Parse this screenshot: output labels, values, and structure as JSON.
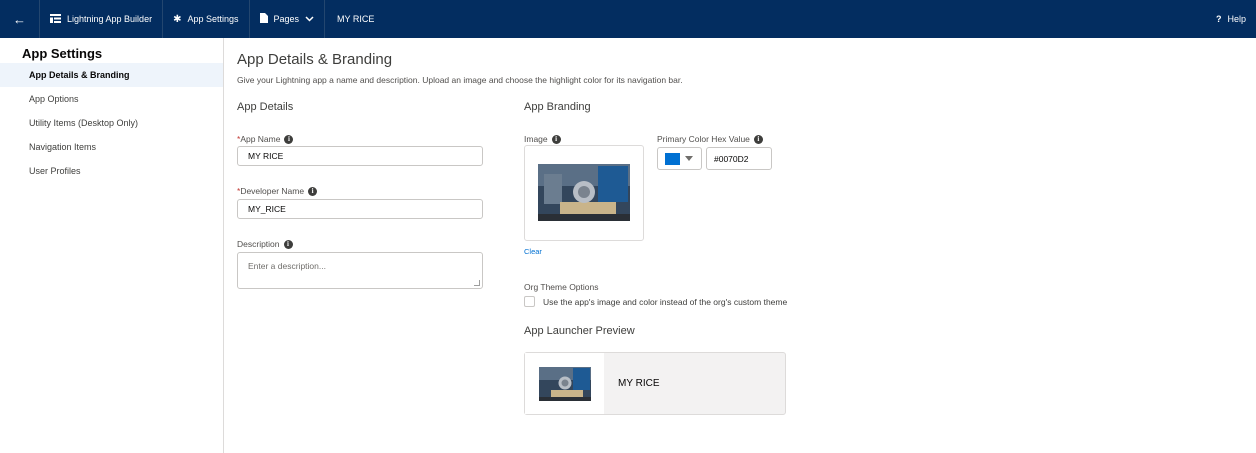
{
  "topbar": {
    "back_icon": "back-arrow-icon",
    "builder_label": "Lightning App Builder",
    "settings_label": "App Settings",
    "pages_label": "Pages",
    "app_title": "MY RICE",
    "help_label": "Help"
  },
  "sidebar": {
    "heading": "App Settings",
    "items": [
      {
        "label": "App Details & Branding",
        "active": true
      },
      {
        "label": "App Options",
        "active": false
      },
      {
        "label": "Utility Items (Desktop Only)",
        "active": false
      },
      {
        "label": "Navigation Items",
        "active": false
      },
      {
        "label": "User Profiles",
        "active": false
      }
    ]
  },
  "main": {
    "title": "App Details & Branding",
    "subtitle": "Give your Lightning app a name and description. Upload an image and choose the highlight color for its navigation bar.",
    "details": {
      "heading": "App Details",
      "app_name_label": "App Name",
      "app_name_value": "MY RICE",
      "dev_name_label": "Developer Name",
      "dev_name_value": "MY_RICE",
      "description_label": "Description",
      "description_placeholder": "Enter a description..."
    },
    "branding": {
      "heading": "App Branding",
      "image_label": "Image",
      "clear_label": "Clear",
      "color_label": "Primary Color Hex Value",
      "color_value": "#0070D2",
      "swatch_color": "#0070d2",
      "org_theme_label": "Org Theme Options",
      "org_theme_checkbox_label": "Use the app's image and color instead of the org's custom theme",
      "org_theme_checked": false,
      "preview_heading": "App Launcher Preview",
      "preview_name": "MY RICE"
    }
  },
  "required_mark": "*",
  "info_glyph": "i"
}
